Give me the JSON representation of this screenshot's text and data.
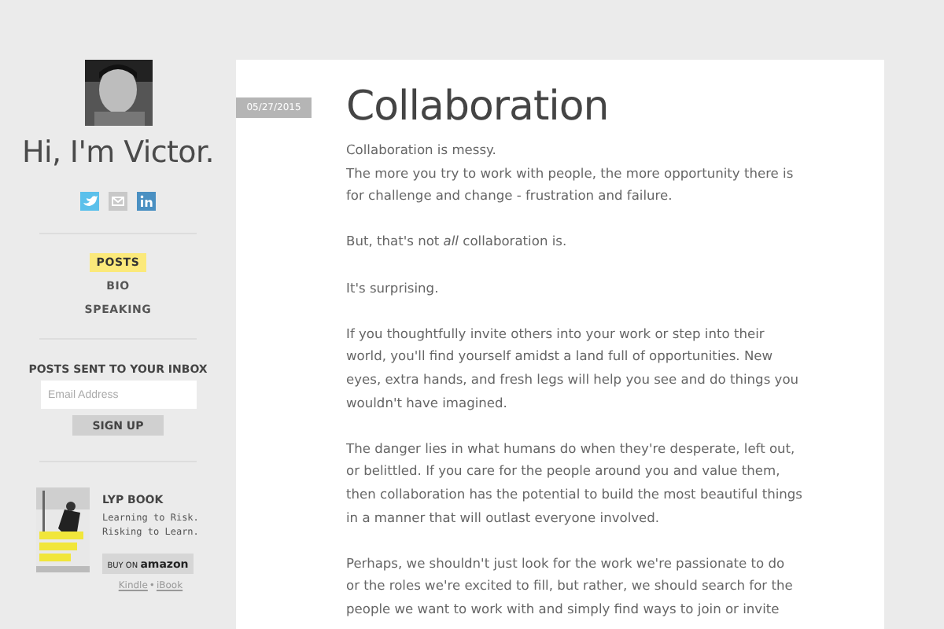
{
  "sidebar": {
    "greeting": "Hi, I'm Victor.",
    "social": [
      {
        "kind": "twitter"
      },
      {
        "kind": "email"
      },
      {
        "kind": "linkedin"
      }
    ],
    "nav": [
      {
        "label": "POSTS",
        "selected": true
      },
      {
        "label": "BIO",
        "selected": false
      },
      {
        "label": "SPEAKING",
        "selected": false
      }
    ],
    "newsletter": {
      "heading": "POSTS SENT TO YOUR INBOX",
      "placeholder": "Email Address",
      "button": "SIGN UP"
    },
    "book": {
      "title": "LYP BOOK",
      "tagline": [
        "Learning to Risk.",
        "Risking to Learn."
      ],
      "buy_button": {
        "pre": "BUY ON",
        "brand": "amazon"
      },
      "links": [
        "Kindle",
        "iBook"
      ],
      "separator": "•"
    }
  },
  "post": {
    "date": "05/27/2015",
    "title": "Collaboration",
    "paragraphs": [
      {
        "lines": [
          "Collaboration is messy.",
          "The more you try to work with people, the more opportunity there is",
          "for challenge and change - frustration and failure."
        ]
      },
      {
        "lines": [
          "But, that's not *all* collaboration is."
        ]
      },
      {
        "lines": [
          "It's surprising."
        ]
      },
      {
        "lines": [
          "If you thoughtfully invite others into your work or step into their",
          "world, you'll find yourself amidst a land full of opportunities. New",
          "eyes, extra hands, and fresh legs will help you see and do things you",
          "wouldn't have imagined."
        ]
      },
      {
        "lines": [
          "The danger lies in what humans do when they're desperate, left out,",
          "or belittled. If you care for the people around you and value them,",
          "then collaboration has the potential to build the most beautiful things",
          "in a manner that will outlast everyone involved."
        ]
      },
      {
        "lines": [
          "Perhaps, we shouldn't just look for the work we're passionate to do",
          "or the roles we're excited to fill, but rather, we should search for the",
          "people we want to work with and simply find ways to join or invite"
        ]
      }
    ]
  }
}
